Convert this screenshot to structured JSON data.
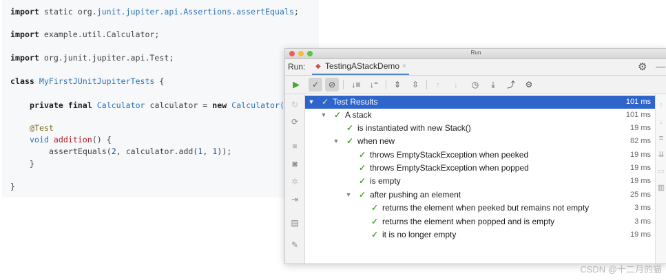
{
  "code": {
    "lines": [
      [
        "import",
        " static org.",
        "junit.jupiter.api.Assertions.assertEquals",
        ";"
      ],
      [
        "import",
        " example.util.Calculator;"
      ],
      [
        "import",
        " org.junit.jupiter.api.Test;"
      ],
      [
        "class",
        " ",
        "MyFirstJUnitJupiterTests",
        " {"
      ],
      [
        "private final",
        " ",
        "Calculator",
        " calculator = ",
        "new",
        " ",
        "Calculator();"
      ],
      [
        "@Test"
      ],
      [
        "void",
        " ",
        "addition",
        "() {"
      ],
      [
        "assertEquals(",
        "2",
        ", calculator.add(",
        "1",
        ", ",
        "1",
        "));"
      ],
      [
        "}"
      ],
      [
        "}"
      ]
    ]
  },
  "window": {
    "title": "Run",
    "run_label": "Run:",
    "tab": {
      "label": "TestingAStackDemo",
      "close": "×"
    },
    "settings_icon": "gear-icon"
  },
  "toolbar": {
    "icons": [
      "run-icon",
      "show-passed-icon",
      "show-ignored-icon",
      "sort-alphabetically-icon",
      "sort-by-duration-icon",
      "expand-all-icon",
      "collapse-all-icon",
      "previous-failed-icon",
      "next-failed-icon",
      "test-history-icon",
      "import-tests-icon",
      "export-tests-icon",
      "settings-icon"
    ]
  },
  "tree": {
    "rows": [
      {
        "label": "Test Results",
        "time": "101 ms",
        "selected": true
      },
      {
        "label": "A stack",
        "time": "101 ms"
      },
      {
        "label": "is instantiated with new Stack()",
        "time": "19 ms"
      },
      {
        "label": "when new",
        "time": "82 ms"
      },
      {
        "label": "throws EmptyStackException when peeked",
        "time": "19 ms"
      },
      {
        "label": "throws EmptyStackException when popped",
        "time": "19 ms"
      },
      {
        "label": "is empty",
        "time": "19 ms"
      },
      {
        "label": "after pushing an element",
        "time": "25 ms"
      },
      {
        "label": "returns the element when peeked but remains not empty",
        "time": "3 ms"
      },
      {
        "label": "returns the element when popped and is empty",
        "time": "3 ms"
      },
      {
        "label": "it is no longer empty",
        "time": "19 ms"
      }
    ]
  },
  "watermark": "CSDN @十二月的猫"
}
